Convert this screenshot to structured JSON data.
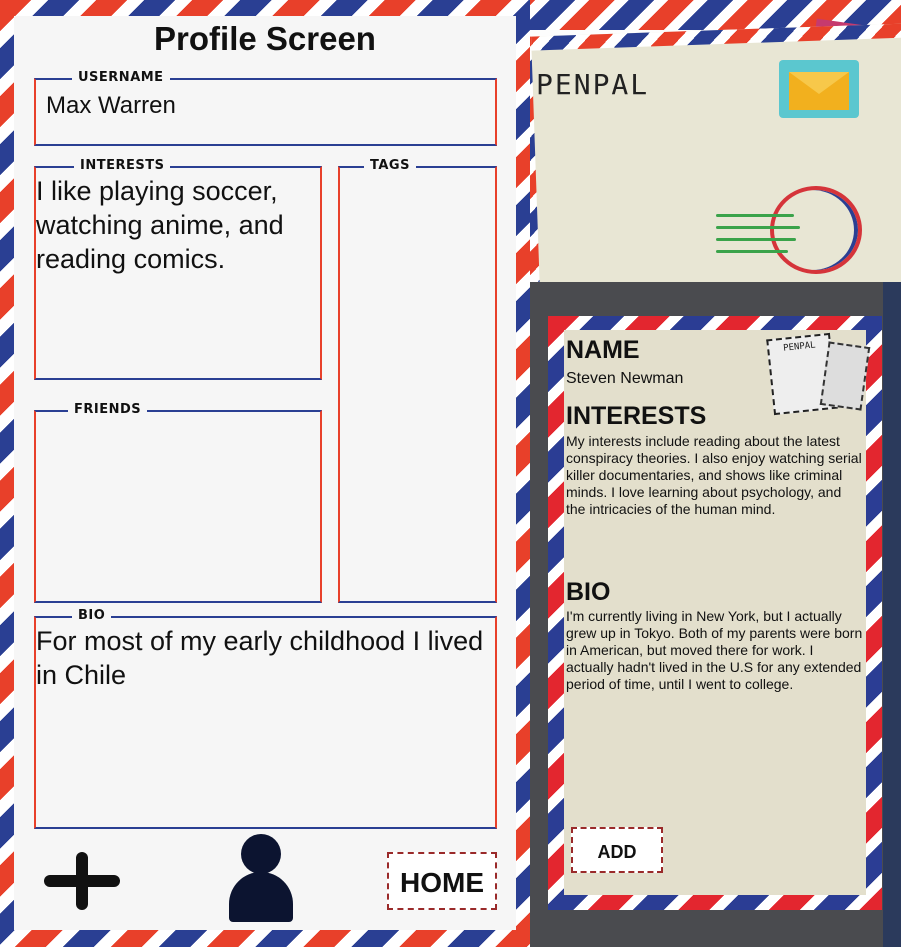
{
  "left_screen": {
    "title": "Profile Screen",
    "username": {
      "label": "USERNAME",
      "value": "Max Warren"
    },
    "interests": {
      "label": "INTERESTS",
      "value": "I like playing soccer, watching anime, and reading comics."
    },
    "tags": {
      "label": "TAGS",
      "value": ""
    },
    "friends": {
      "label": "FRIENDS",
      "value": ""
    },
    "bio": {
      "label": "BIO",
      "value": "For most of my early childhood I lived in Chile"
    },
    "nav": {
      "home_label": "HOME"
    },
    "colors": {
      "red": "#e8402a",
      "blue": "#2a3f93"
    }
  },
  "right_screen": {
    "logo": "PENPAL",
    "stamp_text": "PENPAL",
    "profile": {
      "name_heading": "NAME",
      "name": "Steven Newman",
      "interests_heading": "INTERESTS",
      "interests": "My interests include reading about the latest conspiracy theories. I also enjoy watching serial killer documentaries, and shows like criminal minds. I love learning about psychology, and the intricacies of the human mind.",
      "bio_heading": "BIO",
      "bio": "I'm currently living in New York, but I actually grew up in Tokyo. Both of my parents were born in American, but moved there for work. I actually hadn't lived in the U.S for any extended period of time, until I went to college.",
      "add_label": "ADD"
    }
  }
}
